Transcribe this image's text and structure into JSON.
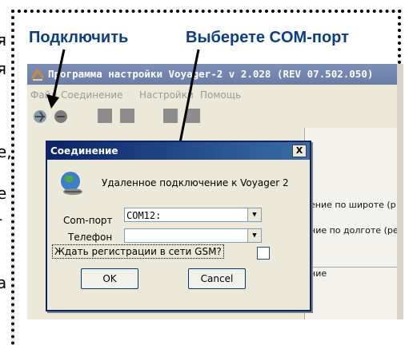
{
  "callouts": {
    "connect": "Подключить",
    "choose_port": "Выберете COM-порт"
  },
  "left_fragments": [
    "я",
    "я",
    "е,",
    "е",
    "-",
    "а"
  ],
  "app": {
    "title": "Программа настройки Voyager-2 v 2.028 (REV 07.502.050)",
    "menu": [
      "Файл",
      "Соединение",
      "Настройки",
      "Помощь"
    ],
    "right_panel": {
      "line1": "ение по широте (р",
      "line2": "ние по долготе (ре",
      "line3": "ние"
    }
  },
  "dialog": {
    "title": "Соединение",
    "close_label": "X",
    "message": "Удаленное подключение к Voyager 2",
    "comport_label": "Com-порт",
    "comport_value": "COM12:",
    "phone_label": "Телефон",
    "phone_value": "",
    "gsm_label": "Ждать регистрации в сети GSM?",
    "ok_label": "OK",
    "cancel_label": "Cancel"
  },
  "colors": {
    "callout": "#0b3d8a",
    "dialog_title_bar": "#0a246a",
    "app_title_bar": "#7b8fb8"
  }
}
